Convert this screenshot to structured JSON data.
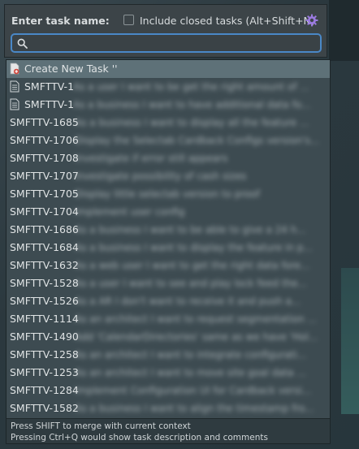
{
  "header": {
    "label": "Enter task name:",
    "include_closed_label": "Include closed tasks (Alt+Shift+N)",
    "include_closed_checked": false,
    "search": {
      "value": "",
      "placeholder": ""
    }
  },
  "list": {
    "create_label": "Create New Task ''",
    "items": [
      {
        "id": "SMFTTV-1",
        "desc": "As a user I want to be get the right amount of ...",
        "icon": "document-icon"
      },
      {
        "id": "SMFTTV-1",
        "desc": "As a business I want to have additional data fo...",
        "icon": "document-icon"
      },
      {
        "id": "SMFTTV-1685",
        "desc": "As a business I want to display all the feature ..."
      },
      {
        "id": "SMFTTV-1706",
        "desc": "Display the Selectab Cardback Configs version's..."
      },
      {
        "id": "SMFTTV-1708",
        "desc": "Investigate if error still appears"
      },
      {
        "id": "SMFTTV-1707",
        "desc": "Investigate possibility of cash sizes"
      },
      {
        "id": "SMFTTV-1705",
        "desc": "Display little selectab version to proof"
      },
      {
        "id": "SMFTTV-1704",
        "desc": "Implement user config"
      },
      {
        "id": "SMFTTV-1686",
        "desc": "As a business I want to be able to give a 24 h..."
      },
      {
        "id": "SMFTTV-1684",
        "desc": "As a business I want to display the feature in p..."
      },
      {
        "id": "SMFTTV-1632",
        "desc": "As a web user I want to get the right data fore..."
      },
      {
        "id": "SMFTTV-1528",
        "desc": "As a user I want to see and play lock feed the..."
      },
      {
        "id": "SMFTTV-1526",
        "desc": "As a AR I don't want to receive it and push a..."
      },
      {
        "id": "SMFTTV-1114",
        "desc": "As an architect I want to request segmentation ..."
      },
      {
        "id": "SMFTTV-1490",
        "desc": "Add 'CalendarDirectories' same as we have 'Hol..."
      },
      {
        "id": "SMFTTV-1258",
        "desc": "As an architect I want to integrate configurati..."
      },
      {
        "id": "SMFTTV-1253",
        "desc": "As an architect I want to move site goal data ..."
      },
      {
        "id": "SMFTTV-1284",
        "desc": "Implement Configuration UI for Cardback versi..."
      },
      {
        "id": "SMFTTV-1582",
        "desc": "As a business I want to align the timestamp fro..."
      }
    ]
  },
  "footer": {
    "line1": "Press SHIFT to merge with current context",
    "line2": "Pressing Ctrl+Q would show task description and comments"
  },
  "colors": {
    "accent_focus": "#4a88c7",
    "gear": "#9b7ae0",
    "selected_row": "#5e7178",
    "new_task_icon": "#d24a3f"
  }
}
